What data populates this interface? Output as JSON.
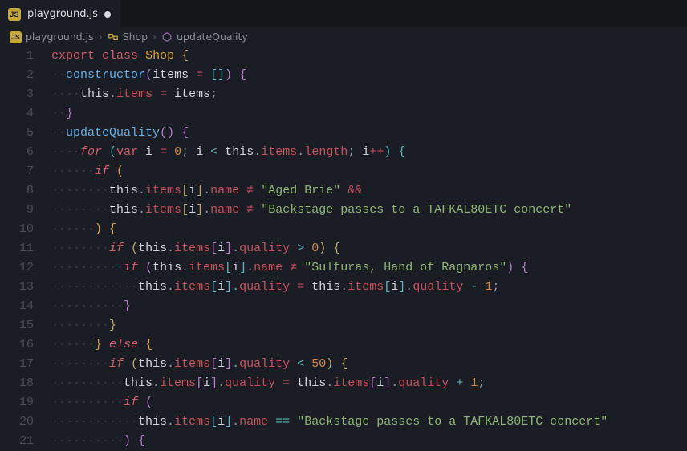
{
  "tab": {
    "filename": "playground.js",
    "modified": true
  },
  "breadcrumb": {
    "file": "playground.js",
    "symbols": [
      "Shop",
      "updateQuality"
    ]
  },
  "gutter": {
    "from": 1,
    "to": 21,
    "current": 4
  },
  "code_lines": [
    [
      [
        "kw",
        "export"
      ],
      [
        "pun",
        " "
      ],
      [
        "kw",
        "class"
      ],
      [
        "pun",
        " "
      ],
      [
        "cls",
        "Shop"
      ],
      [
        "pun",
        " "
      ],
      [
        "par",
        "{"
      ]
    ],
    [
      [
        "ig",
        "··"
      ],
      [
        "fn",
        "constructor"
      ],
      [
        "par2",
        "("
      ],
      [
        "var",
        "items"
      ],
      [
        "pun",
        " "
      ],
      [
        "op2",
        "="
      ],
      [
        "pun",
        " "
      ],
      [
        "par3",
        "["
      ],
      [
        "par3",
        "]"
      ],
      [
        "par2",
        ")"
      ],
      [
        "pun",
        " "
      ],
      [
        "par2",
        "{"
      ]
    ],
    [
      [
        "ig",
        "····"
      ],
      [
        "var",
        "this"
      ],
      [
        "pun",
        "."
      ],
      [
        "prop",
        "items"
      ],
      [
        "pun",
        " "
      ],
      [
        "op2",
        "="
      ],
      [
        "pun",
        " "
      ],
      [
        "var",
        "items"
      ],
      [
        "pun",
        ";"
      ]
    ],
    [
      [
        "ig",
        "··"
      ],
      [
        "par2",
        "}"
      ]
    ],
    [
      [
        "ig",
        "··"
      ],
      [
        "fn",
        "updateQuality"
      ],
      [
        "par2",
        "("
      ],
      [
        "par2",
        ")"
      ],
      [
        "pun",
        " "
      ],
      [
        "par2",
        "{"
      ]
    ],
    [
      [
        "ig",
        "····"
      ],
      [
        "kw2",
        "for"
      ],
      [
        "pun",
        " "
      ],
      [
        "par3",
        "("
      ],
      [
        "kw",
        "var"
      ],
      [
        "pun",
        " "
      ],
      [
        "var",
        "i"
      ],
      [
        "pun",
        " "
      ],
      [
        "op2",
        "="
      ],
      [
        "pun",
        " "
      ],
      [
        "num",
        "0"
      ],
      [
        "pun",
        "; "
      ],
      [
        "var",
        "i"
      ],
      [
        "pun",
        " "
      ],
      [
        "op",
        "<"
      ],
      [
        "pun",
        " "
      ],
      [
        "var",
        "this"
      ],
      [
        "pun",
        "."
      ],
      [
        "prop",
        "items"
      ],
      [
        "pun",
        "."
      ],
      [
        "prop",
        "length"
      ],
      [
        "pun",
        "; "
      ],
      [
        "var",
        "i"
      ],
      [
        "op2",
        "++"
      ],
      [
        "par3",
        ")"
      ],
      [
        "pun",
        " "
      ],
      [
        "par3",
        "{"
      ]
    ],
    [
      [
        "ig",
        "······"
      ],
      [
        "kw2",
        "if"
      ],
      [
        "pun",
        " "
      ],
      [
        "par4",
        "("
      ]
    ],
    [
      [
        "ig",
        "········"
      ],
      [
        "var",
        "this"
      ],
      [
        "pun",
        "."
      ],
      [
        "prop",
        "items"
      ],
      [
        "par",
        "["
      ],
      [
        "var",
        "i"
      ],
      [
        "par",
        "]"
      ],
      [
        "pun",
        "."
      ],
      [
        "prop",
        "name"
      ],
      [
        "pun",
        " "
      ],
      [
        "op2",
        "≠"
      ],
      [
        "pun",
        " "
      ],
      [
        "str",
        "\"Aged Brie\""
      ],
      [
        "pun",
        " "
      ],
      [
        "op2",
        "&&"
      ]
    ],
    [
      [
        "ig",
        "········"
      ],
      [
        "var",
        "this"
      ],
      [
        "pun",
        "."
      ],
      [
        "prop",
        "items"
      ],
      [
        "par",
        "["
      ],
      [
        "var",
        "i"
      ],
      [
        "par",
        "]"
      ],
      [
        "pun",
        "."
      ],
      [
        "prop",
        "name"
      ],
      [
        "pun",
        " "
      ],
      [
        "op2",
        "≠"
      ],
      [
        "pun",
        " "
      ],
      [
        "str",
        "\"Backstage passes to a TAFKAL80ETC concert\""
      ]
    ],
    [
      [
        "ig",
        "······"
      ],
      [
        "par4",
        ")"
      ],
      [
        "pun",
        " "
      ],
      [
        "par4",
        "{"
      ]
    ],
    [
      [
        "ig",
        "········"
      ],
      [
        "kw2",
        "if"
      ],
      [
        "pun",
        " "
      ],
      [
        "par",
        "("
      ],
      [
        "var",
        "this"
      ],
      [
        "pun",
        "."
      ],
      [
        "prop",
        "items"
      ],
      [
        "par2",
        "["
      ],
      [
        "var",
        "i"
      ],
      [
        "par2",
        "]"
      ],
      [
        "pun",
        "."
      ],
      [
        "prop",
        "quality"
      ],
      [
        "pun",
        " "
      ],
      [
        "op",
        ">"
      ],
      [
        "pun",
        " "
      ],
      [
        "num",
        "0"
      ],
      [
        "par",
        ")"
      ],
      [
        "pun",
        " "
      ],
      [
        "par",
        "{"
      ]
    ],
    [
      [
        "ig",
        "··········"
      ],
      [
        "kw2",
        "if"
      ],
      [
        "pun",
        " "
      ],
      [
        "par2",
        "("
      ],
      [
        "var",
        "this"
      ],
      [
        "pun",
        "."
      ],
      [
        "prop",
        "items"
      ],
      [
        "par3",
        "["
      ],
      [
        "var",
        "i"
      ],
      [
        "par3",
        "]"
      ],
      [
        "pun",
        "."
      ],
      [
        "prop",
        "name"
      ],
      [
        "pun",
        " "
      ],
      [
        "op2",
        "≠"
      ],
      [
        "pun",
        " "
      ],
      [
        "str",
        "\"Sulfuras, Hand of Ragnaros\""
      ],
      [
        "par2",
        ")"
      ],
      [
        "pun",
        " "
      ],
      [
        "par2",
        "{"
      ]
    ],
    [
      [
        "ig",
        "············"
      ],
      [
        "var",
        "this"
      ],
      [
        "pun",
        "."
      ],
      [
        "prop",
        "items"
      ],
      [
        "par3",
        "["
      ],
      [
        "var",
        "i"
      ],
      [
        "par3",
        "]"
      ],
      [
        "pun",
        "."
      ],
      [
        "prop",
        "quality"
      ],
      [
        "pun",
        " "
      ],
      [
        "op2",
        "="
      ],
      [
        "pun",
        " "
      ],
      [
        "var",
        "this"
      ],
      [
        "pun",
        "."
      ],
      [
        "prop",
        "items"
      ],
      [
        "par3",
        "["
      ],
      [
        "var",
        "i"
      ],
      [
        "par3",
        "]"
      ],
      [
        "pun",
        "."
      ],
      [
        "prop",
        "quality"
      ],
      [
        "pun",
        " "
      ],
      [
        "op",
        "-"
      ],
      [
        "pun",
        " "
      ],
      [
        "num",
        "1"
      ],
      [
        "pun",
        ";"
      ]
    ],
    [
      [
        "ig",
        "··········"
      ],
      [
        "par2",
        "}"
      ]
    ],
    [
      [
        "ig",
        "········"
      ],
      [
        "par",
        "}"
      ]
    ],
    [
      [
        "ig",
        "······"
      ],
      [
        "par4",
        "}"
      ],
      [
        "pun",
        " "
      ],
      [
        "kw2",
        "else"
      ],
      [
        "pun",
        " "
      ],
      [
        "par4",
        "{"
      ]
    ],
    [
      [
        "ig",
        "········"
      ],
      [
        "kw2",
        "if"
      ],
      [
        "pun",
        " "
      ],
      [
        "par",
        "("
      ],
      [
        "var",
        "this"
      ],
      [
        "pun",
        "."
      ],
      [
        "prop",
        "items"
      ],
      [
        "par2",
        "["
      ],
      [
        "var",
        "i"
      ],
      [
        "par2",
        "]"
      ],
      [
        "pun",
        "."
      ],
      [
        "prop",
        "quality"
      ],
      [
        "pun",
        " "
      ],
      [
        "op",
        "<"
      ],
      [
        "pun",
        " "
      ],
      [
        "num",
        "50"
      ],
      [
        "par",
        ")"
      ],
      [
        "pun",
        " "
      ],
      [
        "par",
        "{"
      ]
    ],
    [
      [
        "ig",
        "··········"
      ],
      [
        "var",
        "this"
      ],
      [
        "pun",
        "."
      ],
      [
        "prop",
        "items"
      ],
      [
        "par2",
        "["
      ],
      [
        "var",
        "i"
      ],
      [
        "par2",
        "]"
      ],
      [
        "pun",
        "."
      ],
      [
        "prop",
        "quality"
      ],
      [
        "pun",
        " "
      ],
      [
        "op2",
        "="
      ],
      [
        "pun",
        " "
      ],
      [
        "var",
        "this"
      ],
      [
        "pun",
        "."
      ],
      [
        "prop",
        "items"
      ],
      [
        "par2",
        "["
      ],
      [
        "var",
        "i"
      ],
      [
        "par2",
        "]"
      ],
      [
        "pun",
        "."
      ],
      [
        "prop",
        "quality"
      ],
      [
        "pun",
        " "
      ],
      [
        "op",
        "+"
      ],
      [
        "pun",
        " "
      ],
      [
        "num",
        "1"
      ],
      [
        "pun",
        ";"
      ]
    ],
    [
      [
        "ig",
        "··········"
      ],
      [
        "kw2",
        "if"
      ],
      [
        "pun",
        " "
      ],
      [
        "par2",
        "("
      ]
    ],
    [
      [
        "ig",
        "············"
      ],
      [
        "var",
        "this"
      ],
      [
        "pun",
        "."
      ],
      [
        "prop",
        "items"
      ],
      [
        "par3",
        "["
      ],
      [
        "var",
        "i"
      ],
      [
        "par3",
        "]"
      ],
      [
        "pun",
        "."
      ],
      [
        "prop",
        "name"
      ],
      [
        "pun",
        " "
      ],
      [
        "op",
        "=="
      ],
      [
        "pun",
        " "
      ],
      [
        "str",
        "\"Backstage passes to a TAFKAL80ETC concert\""
      ]
    ],
    [
      [
        "ig",
        "··········"
      ],
      [
        "par2",
        ")"
      ],
      [
        "pun",
        " "
      ],
      [
        "par2",
        "{"
      ]
    ]
  ]
}
